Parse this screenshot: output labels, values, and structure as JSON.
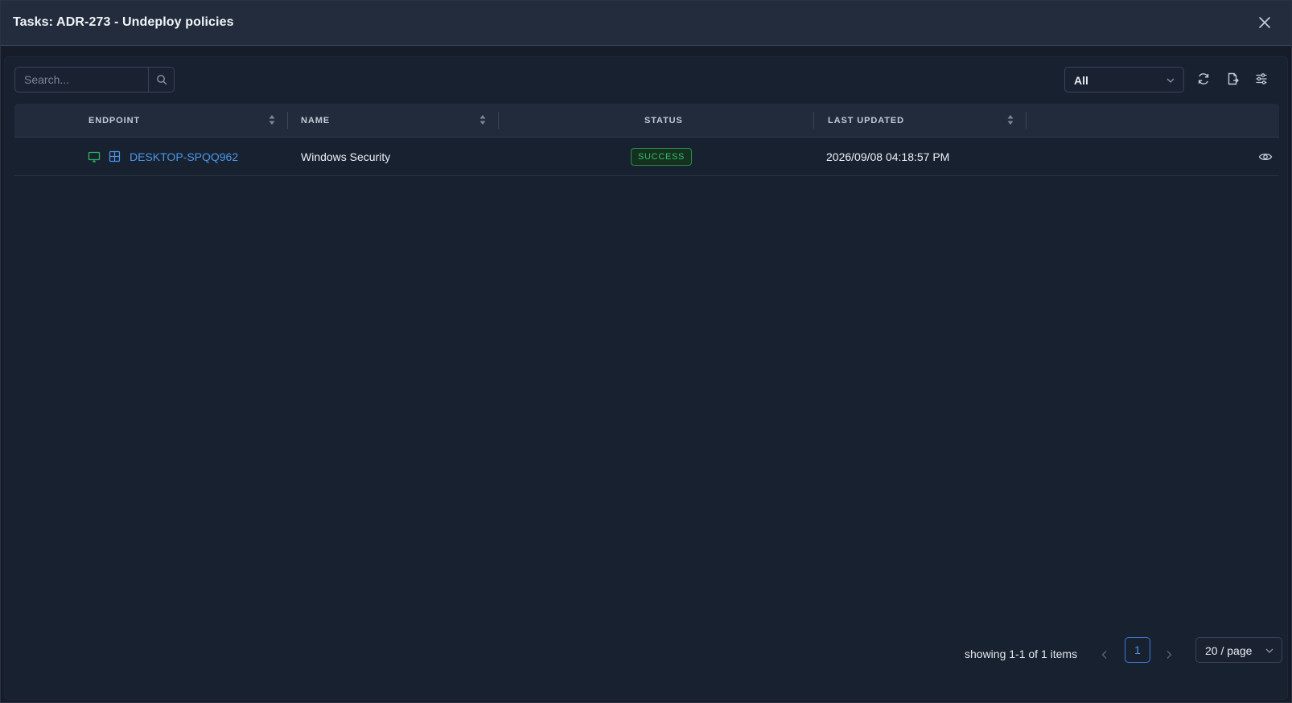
{
  "modal": {
    "title": "Tasks: ADR-273 - Undeploy policies"
  },
  "toolbar": {
    "search_placeholder": "Search...",
    "filter_value": "All",
    "icons": [
      "refresh-icon",
      "export-icon",
      "column-settings-icon"
    ]
  },
  "table": {
    "columns": [
      "ENDPOINT",
      "NAME",
      "STATUS",
      "LAST UPDATED"
    ],
    "rows": [
      {
        "endpoint": "DESKTOP-SPQQ962",
        "name": "Windows Security",
        "status": "SUCCESS",
        "last_updated": "2026/09/08 04:18:57 PM"
      }
    ]
  },
  "pagination": {
    "info": "showing 1-1 of 1 items",
    "current_page": "1",
    "page_size": "20 / page"
  },
  "colors": {
    "link": "#4d96e8",
    "success": "#35c06a",
    "device_online": "#2fb55a"
  }
}
